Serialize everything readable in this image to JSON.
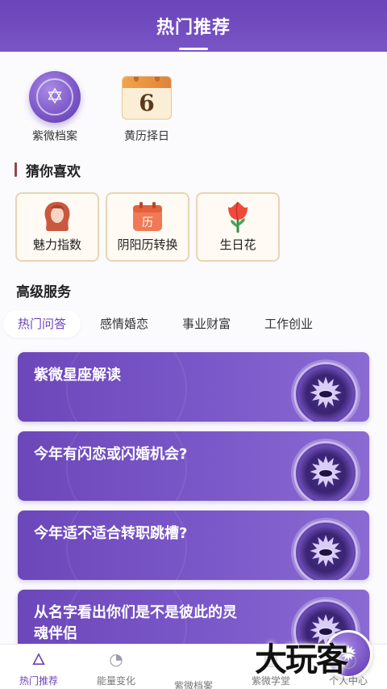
{
  "header": {
    "title": "热门推荐"
  },
  "shortcuts": [
    {
      "label": "紫微档案",
      "icon": "star-of-david-icon"
    },
    {
      "label": "黄历择日",
      "icon": "calendar-icon",
      "calendar_number": "6"
    }
  ],
  "guess": {
    "title": "猜你喜欢",
    "items": [
      {
        "label": "魅力指数",
        "icon": "woman-hair-icon"
      },
      {
        "label": "阴阳历转换",
        "icon": "calendar-convert-icon",
        "icon_glyph": "历"
      },
      {
        "label": "生日花",
        "icon": "tulip-icon"
      }
    ]
  },
  "services": {
    "title": "高级服务",
    "tabs": [
      "热门问答",
      "感情婚恋",
      "事业财富",
      "工作创业"
    ],
    "active_tab": "热门问答",
    "cards": [
      {
        "text": "紫微星座解读"
      },
      {
        "text": "今年有闪恋或闪婚机会?"
      },
      {
        "text": "今年适不适合转职跳槽?"
      },
      {
        "text": "从名字看出你们是不是彼此的灵魂伴侣"
      }
    ]
  },
  "tabbar": {
    "items": [
      {
        "label": "热门推荐",
        "icon": "flame-icon",
        "active": true
      },
      {
        "label": "能量变化",
        "icon": "gauge-icon",
        "active": false
      },
      {
        "label": "紫微档案",
        "icon": "compass-icon",
        "active": false
      },
      {
        "label": "紫微学堂",
        "icon": "book-icon",
        "active": false
      },
      {
        "label": "个人中心",
        "icon": "user-icon",
        "active": false
      }
    ]
  },
  "watermark": "大玩客",
  "colors": {
    "primary": "#6a44b8",
    "card_border": "#ead5b4",
    "background": "#fbfafd"
  }
}
